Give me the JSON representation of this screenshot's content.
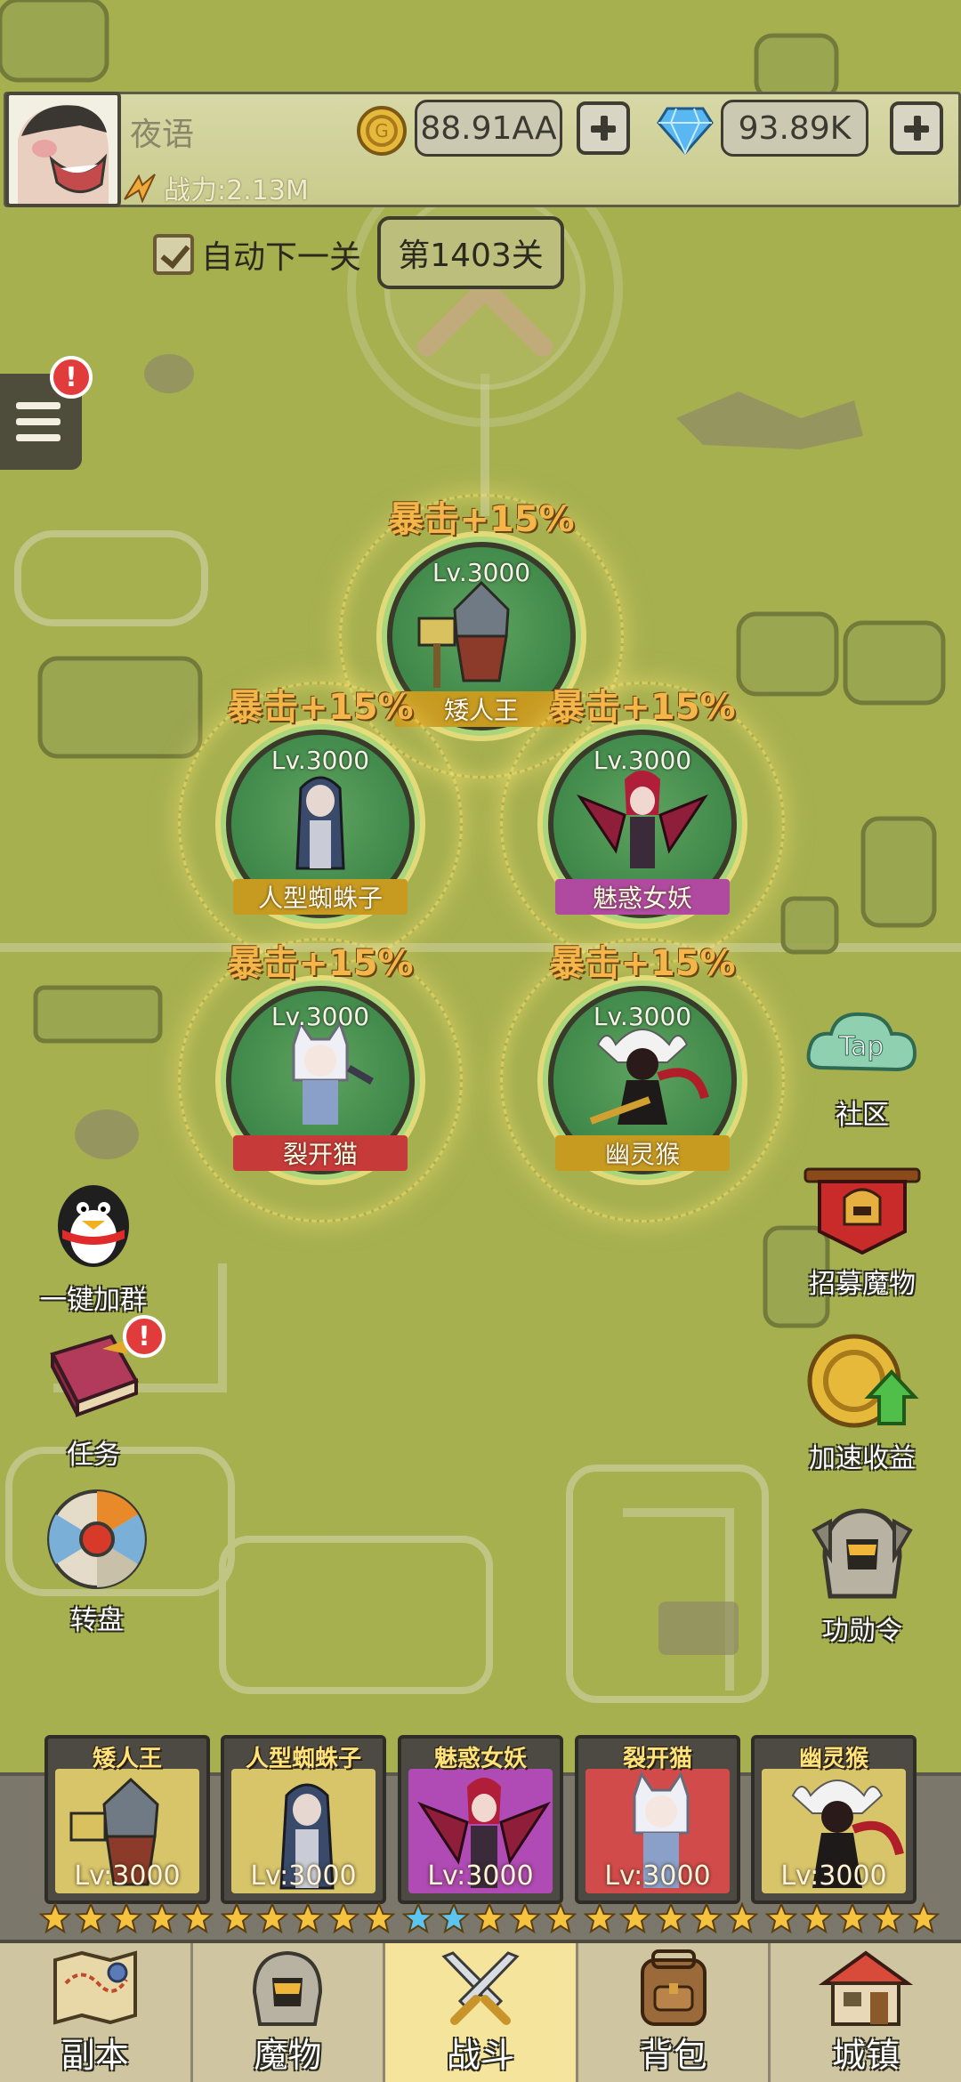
{
  "player": {
    "name": "夜语",
    "power_label": "战力:2.13M"
  },
  "currency": {
    "gold": "88.91AA",
    "diamond": "93.89K"
  },
  "stage": {
    "auto_next_label": "自动下一关",
    "auto_next_checked": true,
    "current_stage": "第1403关"
  },
  "menu": {
    "alert": "!"
  },
  "formation": [
    {
      "name": "矮人王",
      "level": "Lv.3000",
      "bonus": "暴击+15%",
      "ribbon_color": "#c79a20"
    },
    {
      "name": "人型蜘蛛子",
      "level": "Lv.3000",
      "bonus": "暴击+15%",
      "ribbon_color": "#c79a20"
    },
    {
      "name": "魅惑女妖",
      "level": "Lv.3000",
      "bonus": "暴击+15%",
      "ribbon_color": "#b04aa0"
    },
    {
      "name": "裂开猫",
      "level": "Lv.3000",
      "bonus": "暴击+15%",
      "ribbon_color": "#c73a3a"
    },
    {
      "name": "幽灵猴",
      "level": "Lv.3000",
      "bonus": "暴击+15%",
      "ribbon_color": "#c79a20"
    }
  ],
  "left_buttons": [
    {
      "label": "一键加群",
      "icon": "penguin-icon"
    },
    {
      "label": "任务",
      "icon": "quest-book-icon",
      "alert": "!"
    },
    {
      "label": "转盘",
      "icon": "roulette-icon"
    }
  ],
  "right_buttons": [
    {
      "label": "社区",
      "icon": "tap-community-icon",
      "badge": "Tap"
    },
    {
      "label": "招募魔物",
      "icon": "recruit-banner-icon"
    },
    {
      "label": "加速收益",
      "icon": "speed-coin-icon"
    },
    {
      "label": "功勋令",
      "icon": "helmet-icon"
    }
  ],
  "team": [
    {
      "name": "矮人王",
      "level": "Lv:3000",
      "bg": "#d8c56a"
    },
    {
      "name": "人型蜘蛛子",
      "level": "Lv:3000",
      "bg": "#d8c56a"
    },
    {
      "name": "魅惑女妖",
      "level": "Lv:3000",
      "bg": "#b04ab4"
    },
    {
      "name": "裂开猫",
      "level": "Lv:3000",
      "bg": "#d24b4b"
    },
    {
      "name": "幽灵猴",
      "level": "Lv:3000",
      "bg": "#d8c56a"
    }
  ],
  "stars": {
    "gold": "#f6c340",
    "blue": "#5bc4f0"
  },
  "bottom_nav": [
    {
      "label": "副本",
      "icon": "map-scroll-icon"
    },
    {
      "label": "魔物",
      "icon": "monster-helmet-icon"
    },
    {
      "label": "战斗",
      "icon": "crossed-swords-icon",
      "active": true
    },
    {
      "label": "背包",
      "icon": "backpack-icon"
    },
    {
      "label": "城镇",
      "icon": "town-house-icon"
    }
  ]
}
